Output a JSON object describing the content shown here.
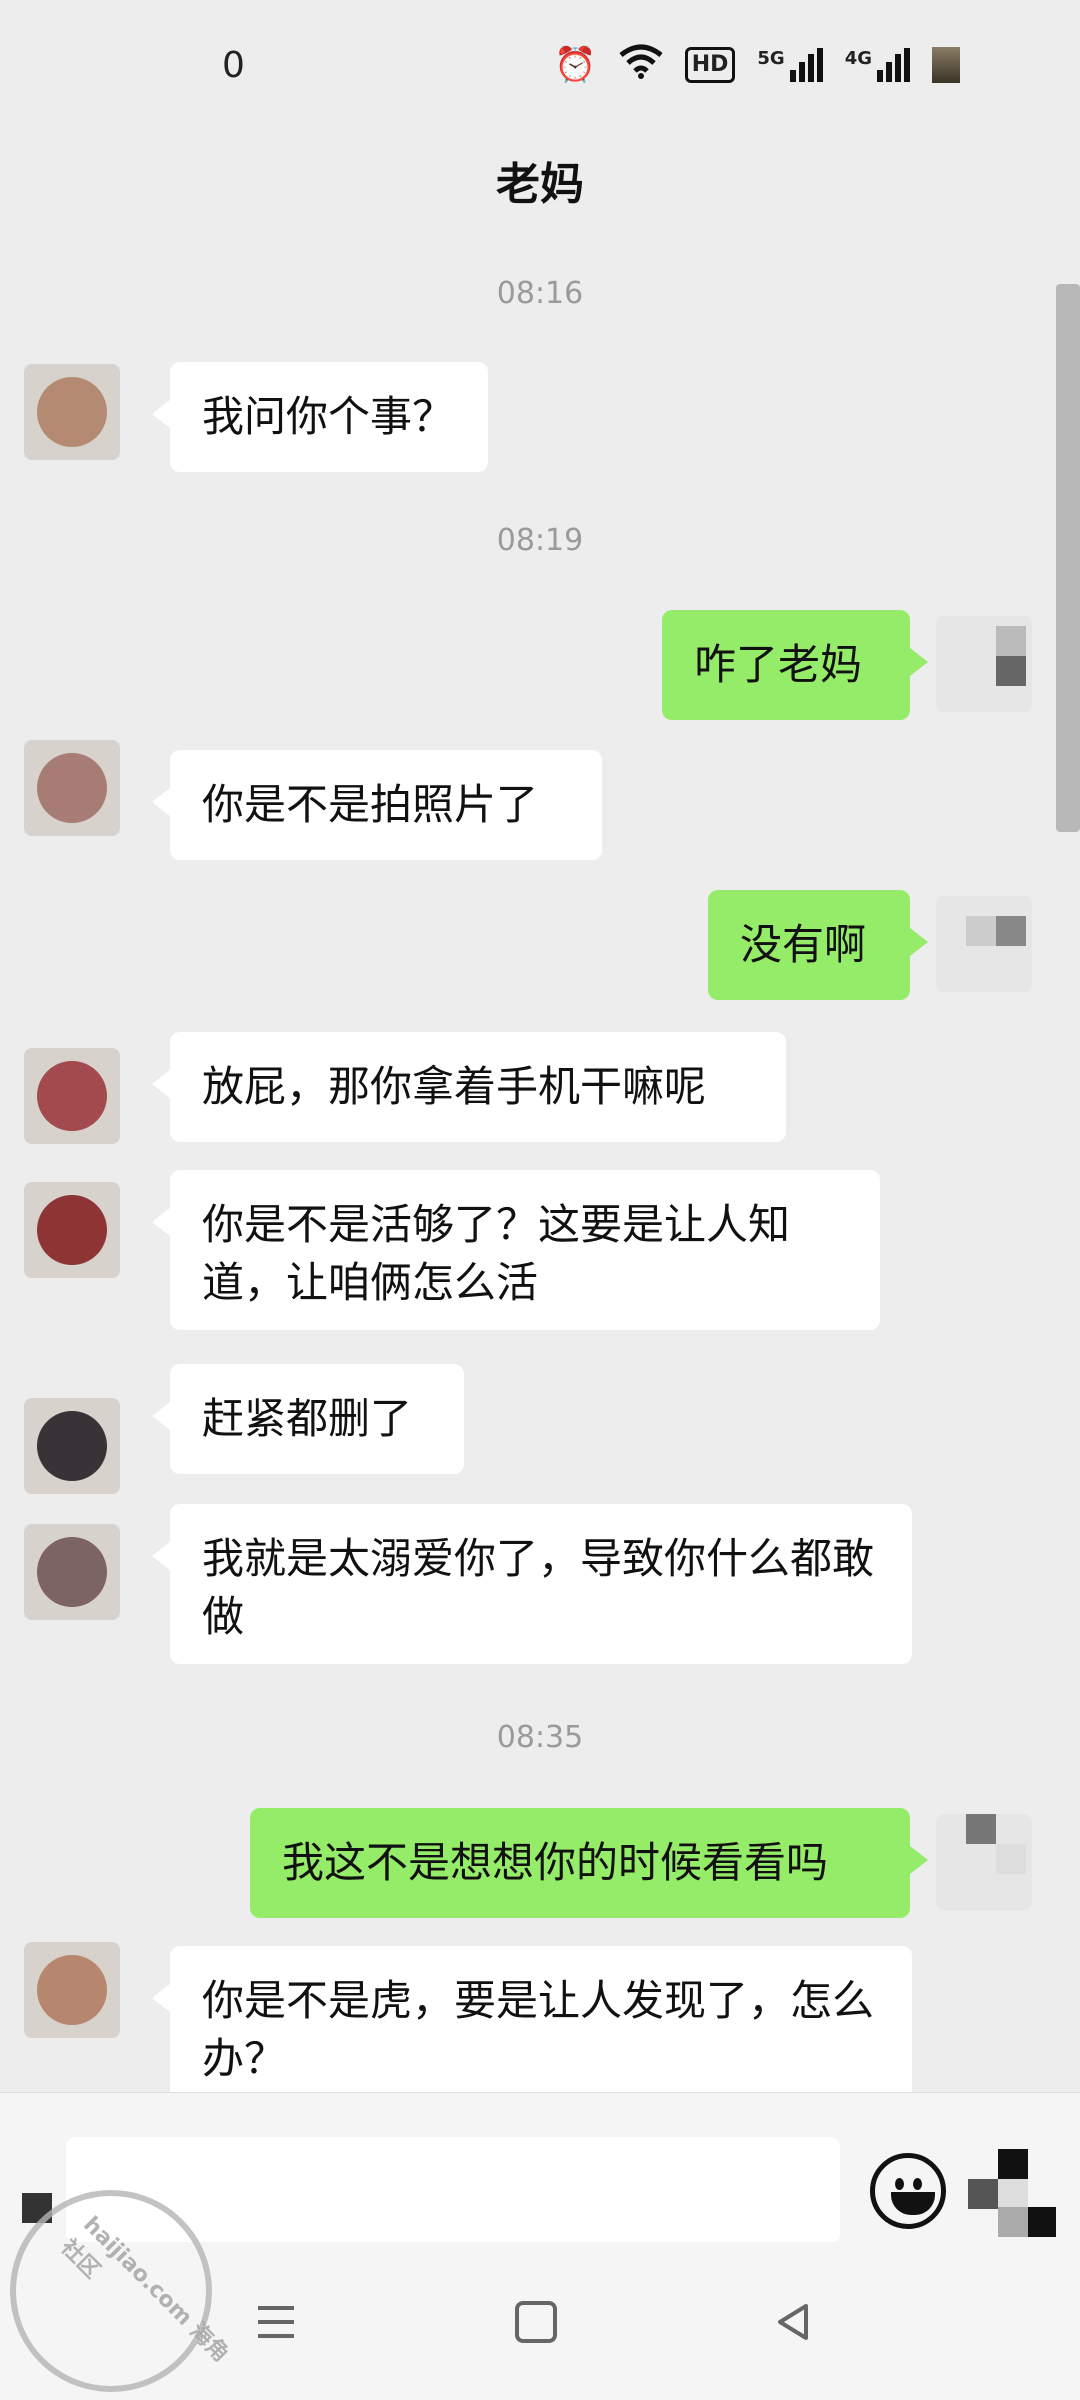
{
  "status_bar": {
    "time": "0",
    "alarm_icon": "alarm-clock-icon",
    "wifi_icon": "wifi-icon",
    "hd_badge": "HD",
    "signal_1_label": "5G",
    "signal_2_label": "4G"
  },
  "header": {
    "title": "老妈"
  },
  "chat": {
    "timestamps": [
      "08:16",
      "08:19",
      "08:35"
    ],
    "messages": [
      {
        "side": "left",
        "text": "我问你个事？"
      },
      {
        "side": "right",
        "text": "咋了老妈"
      },
      {
        "side": "left",
        "text": "你是不是拍照片了"
      },
      {
        "side": "right",
        "text": "没有啊"
      },
      {
        "side": "left",
        "text": "放屁，那你拿着手机干嘛呢"
      },
      {
        "side": "left",
        "text": "你是不是活够了？这要是让人知道，让咱俩怎么活"
      },
      {
        "side": "left",
        "text": "赶紧都删了"
      },
      {
        "side": "left",
        "text": "我就是太溺爱你了，导致你什么都敢做"
      },
      {
        "side": "right",
        "text": "我这不是想想你的时候看看吗"
      },
      {
        "side": "left",
        "text": "你是不是虎，要是让人发现了，怎么办？"
      }
    ]
  },
  "input_bar": {
    "input_value": "",
    "emoji_icon": "emoji-icon",
    "more_icon": "more-icon"
  },
  "nav_bar": {
    "menu_icon": "menu-icon",
    "home_icon": "home-icon",
    "back_icon": "back-icon"
  },
  "watermark": {
    "text": "haijiao.com 海角社区"
  },
  "colors": {
    "background": "#ededed",
    "sent_bubble": "#95ec69",
    "received_bubble": "#ffffff"
  }
}
